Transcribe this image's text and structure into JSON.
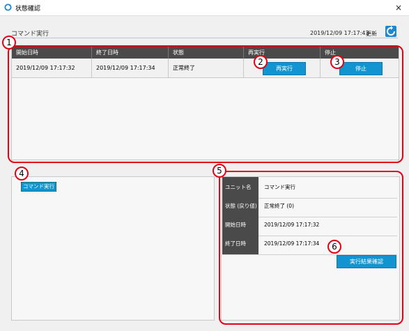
{
  "window": {
    "title": "状態確認",
    "close_icon": "×"
  },
  "header": {
    "label": "コマンド実行",
    "timestamp": "2019/12/09 17:17:43",
    "refresh_label": "更新"
  },
  "grid": {
    "columns": [
      "開始日時",
      "終了日時",
      "状態",
      "再実行",
      "停止"
    ],
    "row": {
      "start": "2019/12/09 17:17:32",
      "end": "2019/12/09 17:17:34",
      "status": "正常終了",
      "rerun_button": "再実行",
      "stop_button": "停止"
    }
  },
  "tree": {
    "item": "コマンド実行"
  },
  "details": {
    "rows": [
      {
        "key": "ユニット名",
        "value": "コマンド実行"
      },
      {
        "key": "状態 (戻り値)",
        "value": "正常終了 (0)"
      },
      {
        "key": "開始日時",
        "value": "2019/12/09 17:17:32"
      },
      {
        "key": "終了日時",
        "value": "2019/12/09 17:17:34"
      }
    ],
    "result_button": "実行結果確認"
  },
  "callouts": [
    "1",
    "2",
    "3",
    "4",
    "5",
    "6"
  ],
  "colors": {
    "accent": "#1194cf",
    "callout": "#e60012",
    "grid_header": "#4a4a4a"
  }
}
